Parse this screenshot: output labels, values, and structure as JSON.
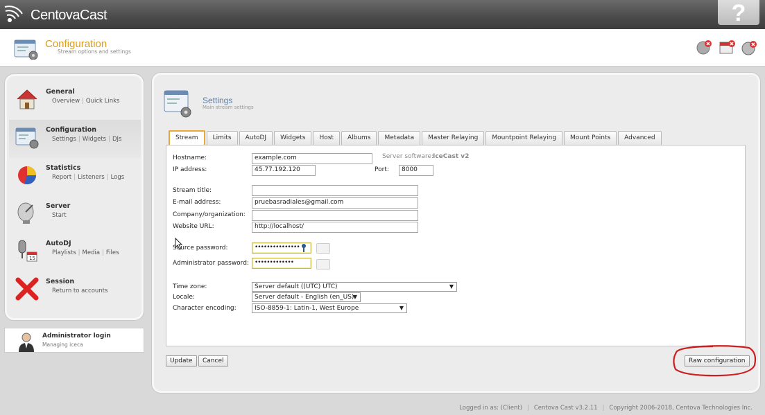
{
  "app": {
    "name": "CentovaCast"
  },
  "page_header": {
    "title": "Configuration",
    "subtitle": "Stream options and settings"
  },
  "sidebar": {
    "items": [
      {
        "name": "General",
        "links": [
          "Overview",
          "Quick Links"
        ]
      },
      {
        "name": "Configuration",
        "links": [
          "Settings",
          "Widgets",
          "DJs"
        ]
      },
      {
        "name": "Statistics",
        "links": [
          "Report",
          "Listeners",
          "Logs"
        ]
      },
      {
        "name": "Server",
        "links": [
          "Start"
        ]
      },
      {
        "name": "AutoDJ",
        "links": [
          "Playlists",
          "Media",
          "Files"
        ]
      },
      {
        "name": "Session",
        "links": [
          "Return to accounts"
        ]
      }
    ],
    "admin": {
      "title": "Administrator login",
      "subtitle": "Managing iceca"
    }
  },
  "main": {
    "title": "Settings",
    "subtitle": "Main stream settings",
    "tabs": [
      "Stream",
      "Limits",
      "AutoDJ",
      "Widgets",
      "Host",
      "Albums",
      "Metadata",
      "Master Relaying",
      "Mountpoint Relaying",
      "Mount Points",
      "Advanced"
    ],
    "active_tab": "Stream"
  },
  "form": {
    "hostname": {
      "label": "Hostname:",
      "value": "example.com"
    },
    "server_software": {
      "label": "Server software:",
      "value": "IceCast v2"
    },
    "ip": {
      "label": "IP address:",
      "value": "45.77.192.120"
    },
    "port": {
      "label": "Port:",
      "value": "8000"
    },
    "stream_title": {
      "label": "Stream title:",
      "value": ""
    },
    "email": {
      "label": "E-mail address:",
      "value": "pruebasradiales@gmail.com"
    },
    "company": {
      "label": "Company/organization:",
      "value": ""
    },
    "website": {
      "label": "Website URL:",
      "value": "http://localhost/"
    },
    "source_password": {
      "label": "Source password:",
      "value": "•••••••••••••••"
    },
    "admin_password": {
      "label": "Administrator password:",
      "value": "•••••••••••••"
    },
    "timezone": {
      "label": "Time zone:",
      "value": "Server default ((UTC) UTC)"
    },
    "locale": {
      "label": "Locale:",
      "value": "Server default - English (en_US)"
    },
    "encoding": {
      "label": "Character encoding:",
      "value": "ISO-8859-1: Latin-1, West Europe"
    }
  },
  "buttons": {
    "update": "Update",
    "cancel": "Cancel",
    "raw": "Raw configuration"
  },
  "footer": {
    "logged": "Logged in as: (Client)",
    "version": "Centova Cast v3.2.11",
    "copyright": "Copyright 2006-2018, Centova Technologies Inc."
  },
  "colors": {
    "accent": "#d89c1e",
    "title_blue": "#5b7ea6",
    "annotation": "#cc1f1f"
  }
}
